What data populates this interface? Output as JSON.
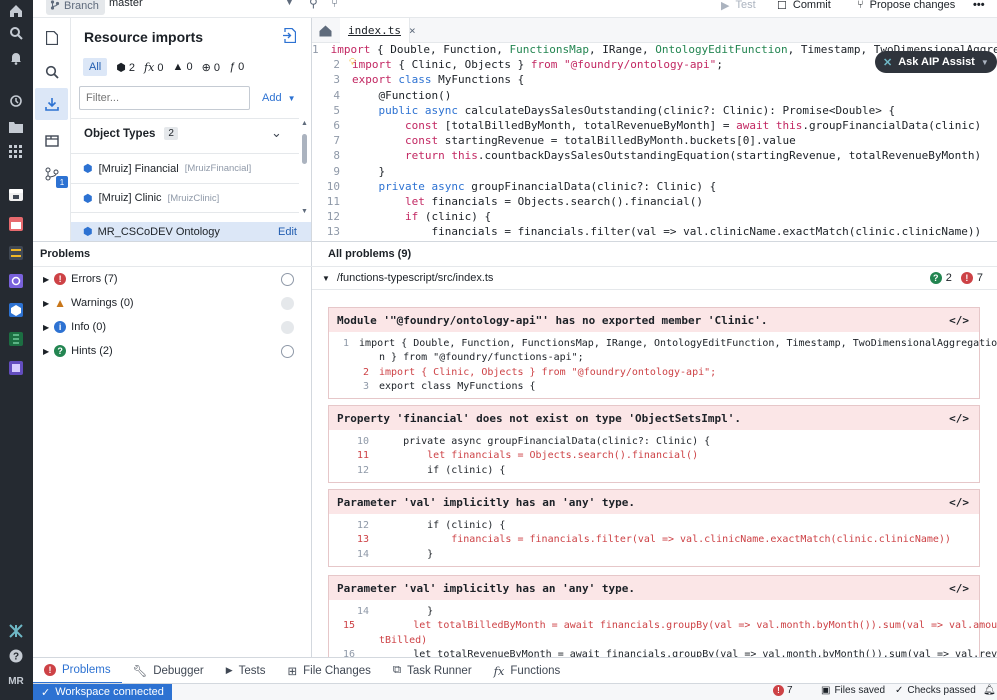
{
  "topbar": {
    "branch_label": "Branch",
    "branch_name": "master",
    "test_label": "Test",
    "commit_label": "Commit",
    "propose_label": "Propose changes",
    "more": "•••"
  },
  "rail": {
    "avatar": "MR"
  },
  "resources": {
    "title": "Resource imports",
    "filters": {
      "all": "All",
      "objects": "2",
      "functions": "0",
      "links": "0",
      "web": "0",
      "other": "0"
    },
    "filter_placeholder": "Filter...",
    "add_label": "Add",
    "object_types_label": "Object Types",
    "object_types_count": "2",
    "items": [
      {
        "label": "[Mruiz] Financial",
        "api": "[MruizFinancial]"
      },
      {
        "label": "[Mruiz] Clinic",
        "api": "[MruizClinic]"
      }
    ],
    "ontology": "MR_CSCoDEV Ontology",
    "edit_label": "Edit",
    "badge": "1"
  },
  "editor": {
    "tab": "index.ts",
    "tab_close": "×",
    "aip_label": "Ask AIP Assist"
  },
  "code": [
    {
      "n": "1",
      "t": "import { Double, Function, FunctionsMap, IRange, OntologyEditFunction, Timestamp, TwoDimensionalAggre"
    },
    {
      "n": "2",
      "t": "import { Clinic, Objects } from \"@foundry/ontology-api\";"
    },
    {
      "n": "3",
      "t": "export class MyFunctions {"
    },
    {
      "n": "4",
      "t": "    @Function()"
    },
    {
      "n": "5",
      "t": "    public async calculateDaysSalesOutstanding(clinic?: Clinic): Promise<Double> {"
    },
    {
      "n": "6",
      "t": "        const [totalBilledByMonth, totalRevenueByMonth] = await this.groupFinancialData(clinic)"
    },
    {
      "n": "7",
      "t": "        const startingRevenue = totalBilledByMonth.buckets[0].value"
    },
    {
      "n": "8",
      "t": "        return this.countbackDaysSalesOutstandingEquation(startingRevenue, totalRevenueByMonth)"
    },
    {
      "n": "9",
      "t": "    }"
    },
    {
      "n": "10",
      "t": "    private async groupFinancialData(clinic?: Clinic) {"
    },
    {
      "n": "11",
      "t": "        let financials = Objects.search().financial()"
    },
    {
      "n": "12",
      "t": "        if (clinic) {"
    },
    {
      "n": "13",
      "t": "            financials = financials.filter(val => val.clinicName.exactMatch(clinic.clinicName))"
    }
  ],
  "problems": {
    "header": "Problems",
    "items": [
      {
        "label": "Errors (7)"
      },
      {
        "label": "Warnings (0)"
      },
      {
        "label": "Info (0)"
      },
      {
        "label": "Hints (2)"
      }
    ],
    "all_label": "All problems (9)",
    "file": "/functions-typescript/src/index.ts",
    "hint_count": "2",
    "error_count": "7"
  },
  "cards": [
    {
      "title": "Module '\"@foundry/ontology-api\"' has no exported member 'Clinic'.",
      "lines": [
        {
          "n": "1",
          "t": "import { Double, Function, FunctionsMap, IRange, OntologyEditFunction, Timestamp, TwoDimensionalAggregatio",
          "err": false
        },
        {
          "n": "",
          "t": "n } from \"@foundry/functions-api\";",
          "err": false
        },
        {
          "n": "2",
          "t": "import { Clinic, Objects } from \"@foundry/ontology-api\";",
          "err": true
        },
        {
          "n": "3",
          "t": "export class MyFunctions {",
          "err": false
        }
      ]
    },
    {
      "title": "Property 'financial' does not exist on type 'ObjectSetsImpl'.",
      "lines": [
        {
          "n": "10",
          "t": "    private async groupFinancialData(clinic?: Clinic) {",
          "err": false
        },
        {
          "n": "11",
          "t": "        let financials = Objects.search().financial()",
          "err": true
        },
        {
          "n": "12",
          "t": "        if (clinic) {",
          "err": false
        }
      ]
    },
    {
      "title": "Parameter 'val' implicitly has an 'any' type.",
      "lines": [
        {
          "n": "12",
          "t": "        if (clinic) {",
          "err": false
        },
        {
          "n": "13",
          "t": "            financials = financials.filter(val => val.clinicName.exactMatch(clinic.clinicName))",
          "err": true
        },
        {
          "n": "14",
          "t": "        }",
          "err": false
        }
      ]
    },
    {
      "title": "Parameter 'val' implicitly has an 'any' type.",
      "lines": [
        {
          "n": "14",
          "t": "        }",
          "err": false
        },
        {
          "n": "15",
          "t": "        let totalBilledByMonth = await financials.groupBy(val => val.month.byMonth()).sum(val => val.amoun",
          "err": true
        },
        {
          "n": "",
          "t": "tBilled)",
          "err": true
        },
        {
          "n": "16",
          "t": "        let totalRevenueByMonth = await financials.groupBy(val => val.month.byMonth()).sum(val => val.reve",
          "err": false
        }
      ]
    }
  ],
  "bottom_tabs": [
    "Problems",
    "Debugger",
    "Tests",
    "File Changes",
    "Task Runner",
    "Functions"
  ],
  "status": {
    "workspace": "Workspace connected",
    "errors": "7",
    "files": "Files saved",
    "checks": "Checks passed"
  },
  "colors": {
    "accent": "#2d72d2",
    "error": "#cd4246",
    "hint": "#238551",
    "warning": "#c87619"
  }
}
